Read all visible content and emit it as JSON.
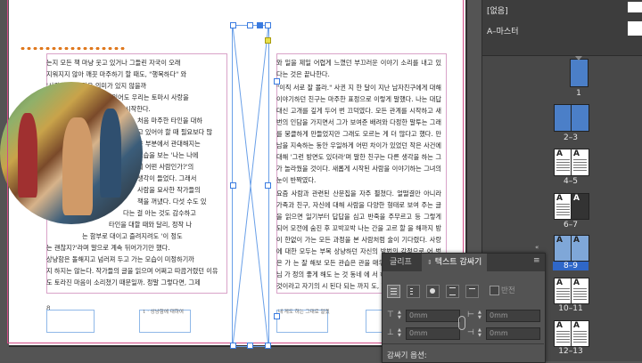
{
  "layout_text": {
    "left_column_lines": [
      "는지 모든 책 마냥 웃고 있거나 그들린 자국이 오래",
      "지워지지 않아 깨끗 마주하기 할 때도, \"행복하다\" 와",
      "'사랑한다'는 같은 의미가 있지 않을까",
      "앞고 있어도 우리는 토마시 사랑을",
      "시작한다.",
      "처음 마주한 타인을 대하",
      "고 있어야 할 때 필요보다 많",
      "은 부분에서 관대해지는",
      "모습을 보는 '나는 나에",
      "게 어떤 사람인가?'의",
      "생각이 들었다. 그래서",
      "사람을 묘사한 작가들의",
      "책을 꺼냈다. 다섯 수도 있",
      "다는 걸 아는 것도 감수하고",
      "타인을 대할 때와 달리, 정작 나",
      "는 함부로 대이고 즐려지려도 '이 정도",
      "는 괜찮지?'라며 말으로 계속 뒤어가기만 했다.",
      "상냥함은 돌해지고 넘러져 두고 가는 모습이 미정하기까",
      "지 하지는 않는다. 작가들의 글을 읽으며 어쩌고 따끔거렸던 이유",
      "도 토라진 마음이 소리쳤기 때문일까. 정말 그렇다면, 그제",
      "서 산문집으로 손을 뻗게 만든 것이라면 잘못을 않아"
    ],
    "right_column_paragraphs": [
      "와 일을 제일 어렵게 느꼈던 부끄러운 이야기 소리를 내고 있다는 것은 끝나한다.",
      "\"이직 서로 잘 몰라.\" 사귄 지 한 달이 지난 남자친구에게 대해 이야기하던 친구는 마주한 표정으로 이렇게 말했다. 나는 대답 대신 고개를 깊게 두어 번 끄덕였다. 모든 관계를 시작하고 새 번의 인담을 가지면서 그가 보여준 배려와 다정한 말투는 그래를 뭉클하게 만들었지만 그래도 모르는 게 더 많다고 했다. 만남을 지속하는 동안 우일하게 어떤 차이가 있었던 작은 사건에 대해 '그런 방면도 있더라'며 말한 친구는 다른 생각을 하는 그가 놀라웠을 것이다. 새롭게 시작된 사람을 이야기하는 그녀의 눈이 반짝였다.",
      "요즘 사람과 관련된 산문집을 자주 펼쳤다. 얼떨결만 아니라 가족과 친구, 자신에 대해 사람을 다양한 형태로 보여 주는 글을 읽으면 일기부터 답답을 심고 반죽을 주무르고 등 그렇게 되어 모전에 숨진 후 꼬박꼬박 나는 간을 고르 할 을 해까지 방이 한없이 가는 모든 과정을 본 사람처럼 술이 기다렸다. 사랑에 대한 모두는 부복 상냥하던 자신의 방법의 감정으로 어 벗은 가 는 잘 해보 모든 관습은 관을 매우 살 지 기다렸을 선생님 가 정의 좋게 해도 는 것 동네 에 서 하기에 정도 말 말의 는 것이라고 자기의 시 된다 되는 까지 도, 항상 두 들"
    ],
    "folio_left": "8",
    "runner_left": "1 · 상냥함에 대하여",
    "runner_right": "내 게도 하는 그대로 알겠",
    "folio_right": "9"
  },
  "pages_panel": {
    "none_label": "[없음]",
    "master_label": "A–마스터",
    "pages": [
      {
        "label": "1",
        "selected": false
      },
      {
        "label": "2–3",
        "selected": false
      },
      {
        "label": "4–5",
        "selected": false
      },
      {
        "label": "6–7",
        "selected": false
      },
      {
        "label": "8–9",
        "selected": true
      },
      {
        "label": "10–11",
        "selected": false
      },
      {
        "label": "12–13",
        "selected": false
      }
    ],
    "thumb_letter": "A"
  },
  "text_wrap_panel": {
    "tabs": [
      {
        "label": "글리프",
        "active": false
      },
      {
        "label": "텍스트 감싸기",
        "active": true
      }
    ],
    "collapse_glyph": "«",
    "menu_glyph": "≡",
    "flip_label": "반전",
    "top_offset": "0mm",
    "bottom_offset": "0mm",
    "left_offset": "0mm",
    "right_offset": "0mm",
    "options_label": "감싸기 옵션:"
  },
  "colors": {
    "selection_blue": "#3a7be0",
    "bleed_pink": "#d14b86",
    "margin_pink": "#d9a3c9",
    "dot_orange": "#e07a20",
    "page_highlight": "#2f67c8"
  }
}
